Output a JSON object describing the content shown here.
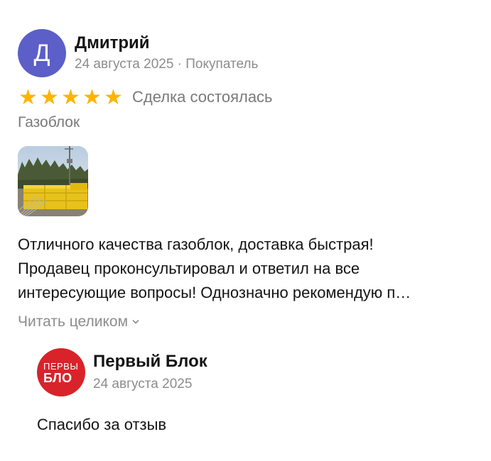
{
  "review": {
    "avatar_letter": "Д",
    "avatar_color": "#5b5fc7",
    "author": "Дмитрий",
    "meta": "24 августа 2025 · Покупатель",
    "rating": 5,
    "rating_max": 5,
    "star_color": "#ffb400",
    "deal_status": "Сделка состоялась",
    "product": "Газоблок",
    "text_lines": [
      "Отличного качества газоблок, доставка быстрая!",
      "Продавец проконсультировал и ответил на все",
      "интересующие вопросы! Однозначно рекомендую п…"
    ],
    "read_more": "Читать целиком"
  },
  "reply": {
    "logo_line1": "ПЕРВЫ",
    "logo_line2": "БЛО",
    "logo_color": "#d8232a",
    "seller": "Первый Блок",
    "date": "24 августа 2025",
    "text": "Спасибо за отзыв"
  }
}
